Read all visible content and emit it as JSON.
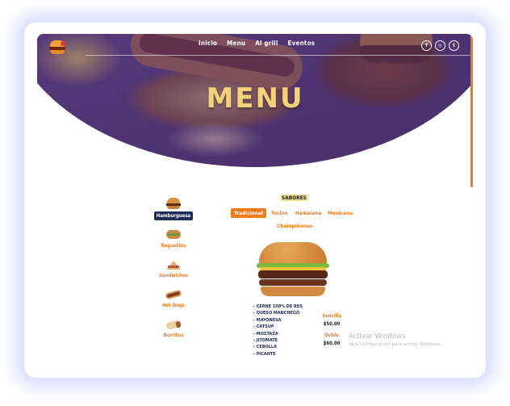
{
  "nav": {
    "items": [
      "Inicio",
      "Menu",
      "Al grill",
      "Eventos"
    ]
  },
  "social": {
    "icons": [
      {
        "name": "facebook-icon",
        "glyph": "f"
      },
      {
        "name": "instagram-icon",
        "glyph": "◎"
      },
      {
        "name": "twitter-icon",
        "glyph": "t"
      }
    ]
  },
  "hero": {
    "title": "MENU"
  },
  "flavors": {
    "title": "SABORES"
  },
  "categories": [
    {
      "label": "Hamburguesa",
      "icon": "hamburger-icon",
      "active": true
    },
    {
      "label": "Baguettes",
      "icon": "baguette-icon",
      "active": false
    },
    {
      "label": "Sandwiches",
      "icon": "sandwich-icon",
      "active": false
    },
    {
      "label": "Hot Dogs",
      "icon": "hotdog-icon",
      "active": false
    },
    {
      "label": "Burritos",
      "icon": "burrito-icon",
      "active": false
    }
  ],
  "tabs": [
    "Tradicional",
    "Tocino",
    "Hawaiana",
    "Mexicana",
    "Champiñones"
  ],
  "ingredients": [
    "- CERNE 100% DE RES",
    "- QUESO MANCHEGO",
    "- MAYONESA",
    "- CATSUP",
    "- MOSTAZA",
    "- JITOMATE",
    "- CEBOLLA",
    "- PICANTE"
  ],
  "prices": [
    {
      "name": "Sencilla",
      "value": "$50.00"
    },
    {
      "name": "Doble",
      "value": "$60.00"
    }
  ],
  "watermark": {
    "title": "Activar Windows",
    "subtitle": "Ve a Configuración para activar Windows."
  },
  "colors": {
    "accent": "#ef7a1a",
    "navy": "#1d2b5a",
    "title": "#f4d27a"
  }
}
